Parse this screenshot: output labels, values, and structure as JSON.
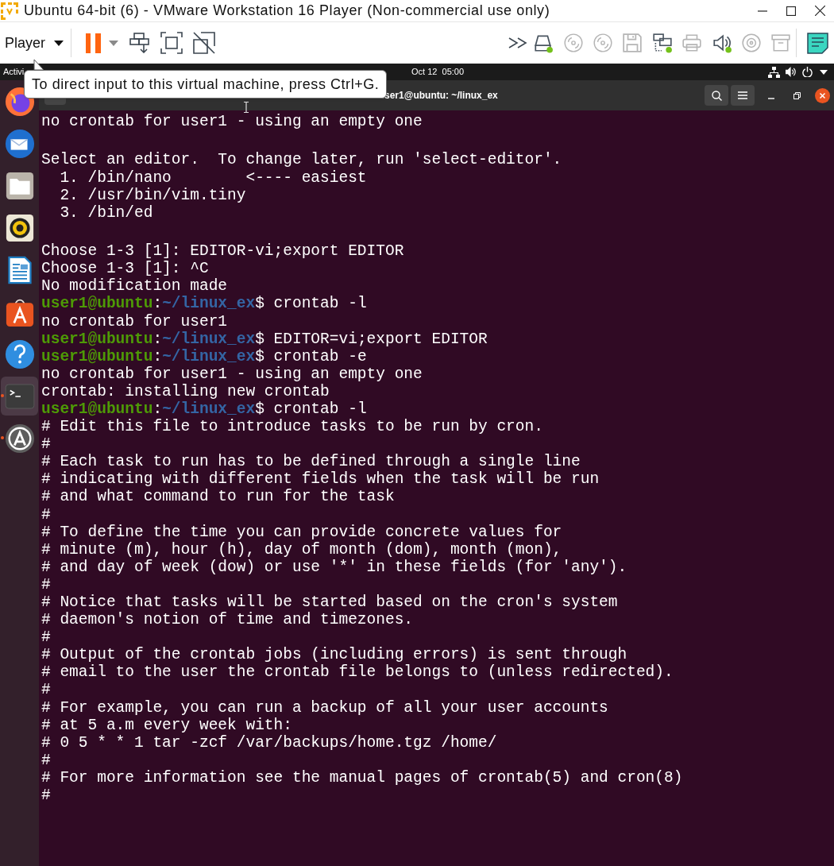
{
  "window": {
    "title": "Ubuntu 64-bit (6) - VMware Workstation 16 Player (Non-commercial use only)"
  },
  "toolbar": {
    "player_menu": "Player",
    "devices": [
      {
        "connected": true
      },
      {
        "connected": false
      },
      {
        "connected": false
      },
      {
        "connected": false
      },
      {
        "connected": true
      },
      {
        "connected": false
      },
      {
        "connected": true
      },
      {
        "connected": false
      },
      {
        "connected": false
      }
    ]
  },
  "tooltip": {
    "text": "To direct input to this virtual machine, press Ctrl+G."
  },
  "top_bar": {
    "activities": "Activi",
    "clock": "Oct 12  05:00"
  },
  "dock": {
    "items": [
      {
        "running": false,
        "selected": false
      },
      {
        "running": false,
        "selected": false
      },
      {
        "running": false,
        "selected": false
      },
      {
        "running": false,
        "selected": false
      },
      {
        "running": false,
        "selected": false
      },
      {
        "running": false,
        "selected": false
      },
      {
        "running": false,
        "selected": false
      },
      {
        "running": true,
        "selected": true
      },
      {
        "running": true,
        "selected": false
      }
    ]
  },
  "terminal": {
    "title": "ser1@ubuntu: ~/linux_ex",
    "lines": [
      {
        "kind": "output",
        "text": "no crontab for user1 - using an empty one"
      },
      {
        "kind": "blank"
      },
      {
        "kind": "output",
        "text": "Select an editor.  To change later, run 'select-editor'."
      },
      {
        "kind": "output",
        "text": "  1. /bin/nano        <---- easiest"
      },
      {
        "kind": "output",
        "text": "  2. /usr/bin/vim.tiny"
      },
      {
        "kind": "output",
        "text": "  3. /bin/ed"
      },
      {
        "kind": "blank"
      },
      {
        "kind": "output",
        "text": "Choose 1-3 [1]: EDITOR-vi;export EDITOR"
      },
      {
        "kind": "output",
        "text": "Choose 1-3 [1]: ^C"
      },
      {
        "kind": "output",
        "text": "No modification made"
      },
      {
        "kind": "prompt",
        "user_host": "user1@ubuntu",
        "separator": ":",
        "cwd": "~/linux_ex",
        "symbol": "$",
        "command": "crontab -l"
      },
      {
        "kind": "output",
        "text": "no crontab for user1"
      },
      {
        "kind": "prompt",
        "user_host": "user1@ubuntu",
        "separator": ":",
        "cwd": "~/linux_ex",
        "symbol": "$",
        "command": "EDITOR=vi;export EDITOR"
      },
      {
        "kind": "prompt",
        "user_host": "user1@ubuntu",
        "separator": ":",
        "cwd": "~/linux_ex",
        "symbol": "$",
        "command": "crontab -e"
      },
      {
        "kind": "output",
        "text": "no crontab for user1 - using an empty one"
      },
      {
        "kind": "output",
        "text": "crontab: installing new crontab"
      },
      {
        "kind": "prompt",
        "user_host": "user1@ubuntu",
        "separator": ":",
        "cwd": "~/linux_ex",
        "symbol": "$",
        "command": "crontab -l"
      },
      {
        "kind": "output",
        "text": "# Edit this file to introduce tasks to be run by cron."
      },
      {
        "kind": "output",
        "text": "#"
      },
      {
        "kind": "output",
        "text": "# Each task to run has to be defined through a single line"
      },
      {
        "kind": "output",
        "text": "# indicating with different fields when the task will be run"
      },
      {
        "kind": "output",
        "text": "# and what command to run for the task"
      },
      {
        "kind": "output",
        "text": "#"
      },
      {
        "kind": "output",
        "text": "# To define the time you can provide concrete values for"
      },
      {
        "kind": "output",
        "text": "# minute (m), hour (h), day of month (dom), month (mon),"
      },
      {
        "kind": "output",
        "text": "# and day of week (dow) or use '*' in these fields (for 'any')."
      },
      {
        "kind": "output",
        "text": "#"
      },
      {
        "kind": "output",
        "text": "# Notice that tasks will be started based on the cron's system"
      },
      {
        "kind": "output",
        "text": "# daemon's notion of time and timezones."
      },
      {
        "kind": "output",
        "text": "#"
      },
      {
        "kind": "output",
        "text": "# Output of the crontab jobs (including errors) is sent through"
      },
      {
        "kind": "output",
        "text": "# email to the user the crontab file belongs to (unless redirected)."
      },
      {
        "kind": "output",
        "text": "#"
      },
      {
        "kind": "output",
        "text": "# For example, you can run a backup of all your user accounts"
      },
      {
        "kind": "output",
        "text": "# at 5 a.m every week with:"
      },
      {
        "kind": "output",
        "text": "# 0 5 * * 1 tar -zcf /var/backups/home.tgz /home/"
      },
      {
        "kind": "output",
        "text": "#"
      },
      {
        "kind": "output",
        "text": "# For more information see the manual pages of crontab(5) and cron(8)"
      },
      {
        "kind": "output",
        "text": "#"
      }
    ]
  }
}
